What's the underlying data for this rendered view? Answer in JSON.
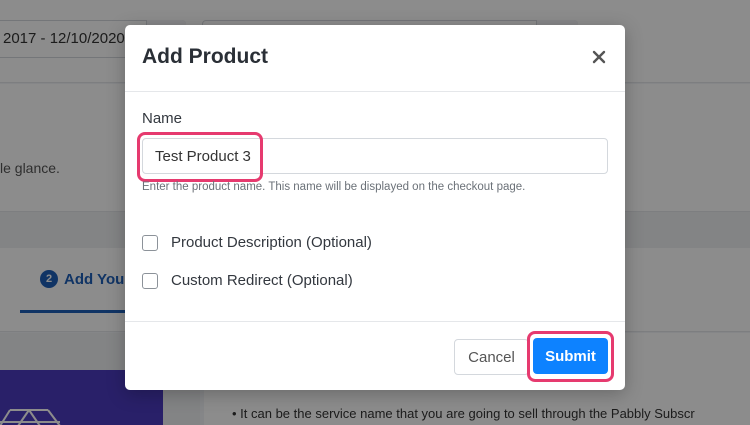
{
  "background": {
    "date_range": "2017 - 12/10/2020",
    "glance_text": "le glance.",
    "step_number": "2",
    "step_label": "Add Your",
    "bullet_text": "It can be the service name that you are going to sell through the Pabbly Subscr"
  },
  "modal": {
    "title": "Add Product",
    "name_label": "Name",
    "name_value": "Test Product 3",
    "name_help": "Enter the product name. This name will be displayed on the checkout page.",
    "options": [
      {
        "label": "Product Description (Optional)",
        "checked": false
      },
      {
        "label": "Custom Redirect (Optional)",
        "checked": false
      }
    ],
    "cancel_label": "Cancel",
    "submit_label": "Submit"
  },
  "colors": {
    "primary": "#0d82ff",
    "highlight": "#e63a6f",
    "step_blue": "#1e5fb8",
    "promo": "#4b3bbf"
  }
}
